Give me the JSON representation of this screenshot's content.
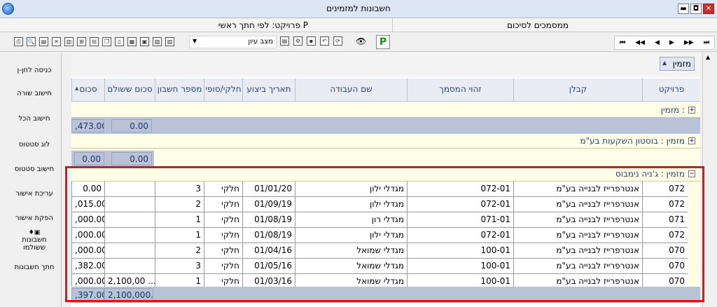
{
  "window": {
    "title": "חשבונות למזמינים",
    "buttons": {
      "minimize": "▬",
      "restore": "◘",
      "close": "✕"
    }
  },
  "info": {
    "project": "פרויקט: לפי חתך ראשי P",
    "documents": "ממסמכים לסיכום"
  },
  "toolbar": {
    "view_mode": "מצב עיון",
    "print_icon": "printer-icon",
    "p_label": "P",
    "nav": [
      "⏮",
      "◀◀",
      "◀",
      "▶",
      "▶▶",
      "⏭"
    ]
  },
  "sidebar": {
    "items": [
      {
        "label": "כניסה לחן-ן"
      },
      {
        "label": "חישוב שורה"
      },
      {
        "label": "חישוב הכל"
      },
      {
        "label": "לוג סטטוס"
      },
      {
        "label": "חישוב סטטוס"
      },
      {
        "label": "עריכת אישור"
      },
      {
        "label": "הפקת אישור"
      },
      {
        "label": "חשבונות ששולמו"
      },
      {
        "label": "חתך חשבונות"
      }
    ]
  },
  "grid": {
    "group_chip": "מזמין",
    "columns": [
      {
        "label": "פרויקט"
      },
      {
        "label": "קבלן"
      },
      {
        "label": "זהוי המסמך"
      },
      {
        "label": "שם העבודה"
      },
      {
        "label": "תאריך ביצוע"
      },
      {
        "label": "חלקי/סופי"
      },
      {
        "label": "מספר חשבון"
      },
      {
        "label": "סכום ששולם"
      },
      {
        "label": "סכום"
      }
    ],
    "groups": [
      {
        "label": "מזמין :",
        "total_amount": ",473.00",
        "total_paid": "0.00"
      },
      {
        "label": "מזמין : בוסטון השקעות בע\"מ",
        "total_amount": "0.00",
        "total_paid": "0.00"
      },
      {
        "label": "מזמין : ג'ניה נימבוס",
        "rows": [
          {
            "project": "072",
            "contractor": "אנטרפרייז לבנייה בע\"מ",
            "doc": "072-01",
            "work": "מגדלי ילון",
            "date": "01/01/20",
            "type": "חלקי",
            "invoice": "3",
            "paid": "",
            "amount": "0.00"
          },
          {
            "project": "072",
            "contractor": "אנטרפרייז לבנייה בע\"מ",
            "doc": "072-01",
            "work": "מגדלי ילון",
            "date": "01/09/19",
            "type": "חלקי",
            "invoice": "2",
            "paid": "",
            "amount": ",015.00"
          },
          {
            "project": "071",
            "contractor": "אנטרפרייז לבנייה בע\"מ",
            "doc": "071-01",
            "work": "מגדלי רון",
            "date": "01/08/19",
            "type": "חלקי",
            "invoice": "1",
            "paid": "",
            "amount": ",000.00"
          },
          {
            "project": "072",
            "contractor": "אנטרפרייז לבנייה בע\"מ",
            "doc": "072-01",
            "work": "מגדלי ילון",
            "date": "01/08/19",
            "type": "חלקי",
            "invoice": "1",
            "paid": "",
            "amount": ",000.00"
          },
          {
            "project": "070",
            "contractor": "אנטרפרייז לבנייה בע\"מ",
            "doc": "100-01",
            "work": "מגדלי שמואל",
            "date": "01/04/16",
            "type": "חלקי",
            "invoice": "2",
            "paid": "",
            "amount": ",000.00"
          },
          {
            "project": "070",
            "contractor": "אנטרפרייז לבנייה בע\"מ",
            "doc": "100-01",
            "work": "מגדלי שמואל",
            "date": "01/05/16",
            "type": "חלקי",
            "invoice": "3",
            "paid": "",
            "amount": ",382.00"
          },
          {
            "project": "070",
            "contractor": "אנטרפרייז לבנייה בע\"מ",
            "doc": "100-01",
            "work": "מגדלי שמואל",
            "date": "01/03/16",
            "type": "חלקי",
            "invoice": "1",
            "paid": "2,100,00 ...",
            "amount": ",000.00 ..."
          }
        ],
        "total_amount": ",397.00",
        "total_paid": "2,100,000.("
      }
    ]
  }
}
